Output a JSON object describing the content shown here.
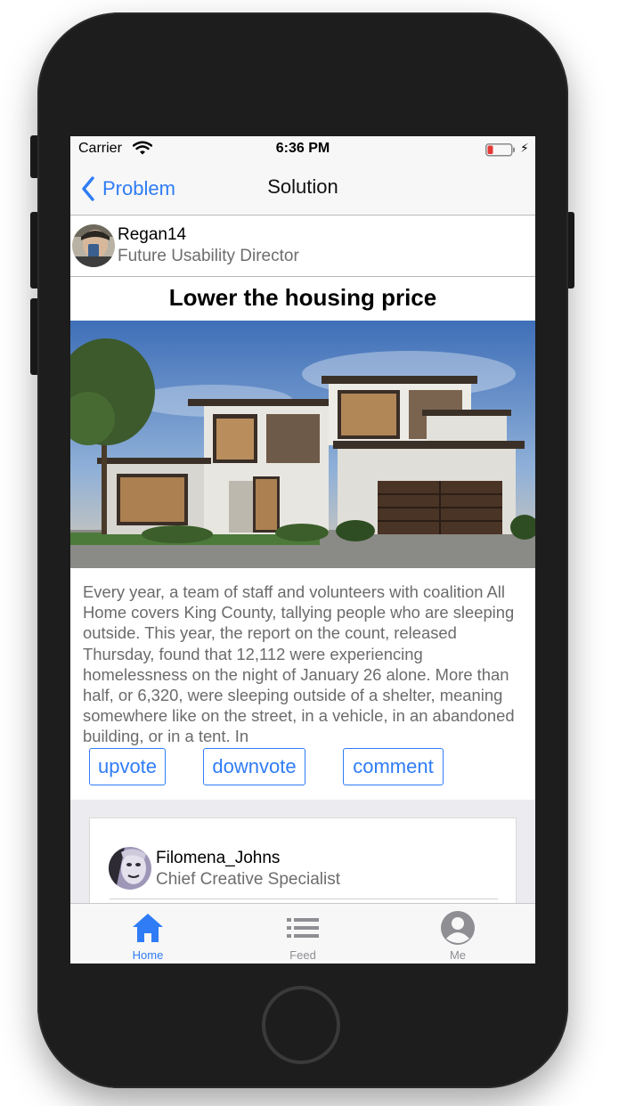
{
  "status_bar": {
    "carrier": "Carrier",
    "time": "6:36 PM"
  },
  "nav": {
    "back_label": "Problem",
    "title": "Solution"
  },
  "author": {
    "name": "Regan14",
    "role": "Future Usability Director"
  },
  "post": {
    "title": "Lower the housing price",
    "body": "Every year, a team of staff and volunteers with coalition All Home covers King County, tallying people who are sleeping outside. This year, the report on the count, released Thursday, found that 12,112 were experiencing homelessness on the night of January 26 alone. More than half, or 6,320, were sleeping outside of a shelter, meaning somewhere like on the street, in a vehicle, in an abandoned building, or in a tent. In"
  },
  "actions": {
    "upvote": "upvote",
    "downvote": "downvote",
    "comment": "comment"
  },
  "comments": [
    {
      "name": "Filomena_Johns",
      "role": "Chief Creative Specialist"
    }
  ],
  "tab_bar": {
    "tabs": [
      {
        "label": "Home",
        "icon": "home-icon",
        "active": true
      },
      {
        "label": "Feed",
        "icon": "list-icon",
        "active": false
      },
      {
        "label": "Me",
        "icon": "profile-icon",
        "active": false
      }
    ]
  },
  "colors": {
    "accent": "#2f7cf6",
    "inactive_tab": "#8e8e93",
    "battery_low": "#e53935"
  }
}
